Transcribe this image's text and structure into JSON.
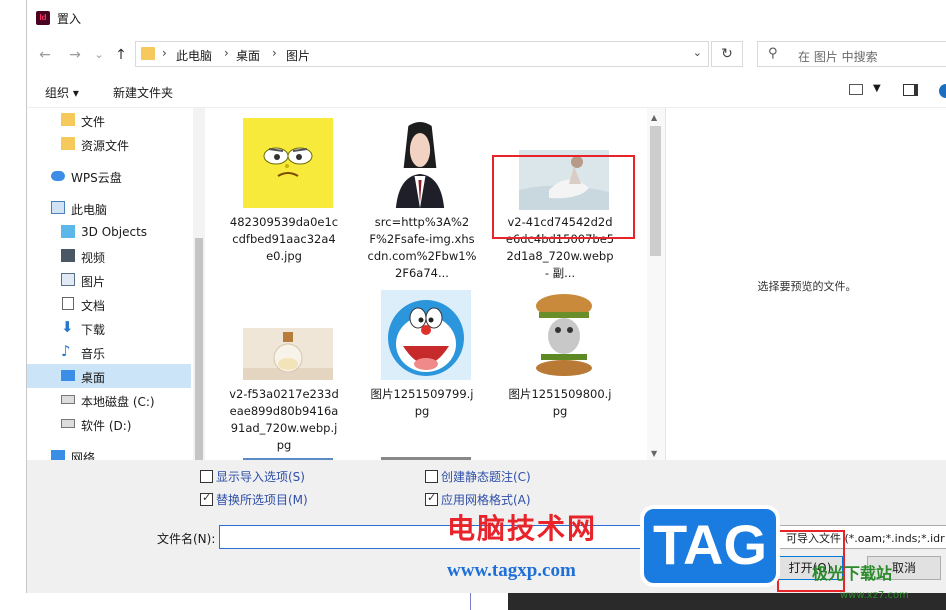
{
  "window": {
    "title": "置入",
    "app_icon_text": "Id"
  },
  "address": {
    "back": "←",
    "forward": "→",
    "recent": "⌄",
    "up": "↑",
    "crumbs": [
      "此电脑",
      "桌面",
      "图片"
    ],
    "search_placeholder": "在 图片 中搜索"
  },
  "toolbar": {
    "organize": "组织 ▾",
    "new_folder": "新建文件夹"
  },
  "sidebar": {
    "items": [
      {
        "label": "文件",
        "icon": "folder-icon"
      },
      {
        "label": "资源文件",
        "icon": "folder-icon"
      },
      {
        "label": "WPS云盘",
        "icon": "cloud-icon"
      },
      {
        "label": "此电脑",
        "icon": "computer-icon"
      },
      {
        "label": "3D Objects",
        "icon": "cube-icon"
      },
      {
        "label": "视频",
        "icon": "video-icon"
      },
      {
        "label": "图片",
        "icon": "picture-icon"
      },
      {
        "label": "文档",
        "icon": "document-icon"
      },
      {
        "label": "下载",
        "icon": "download-icon"
      },
      {
        "label": "音乐",
        "icon": "music-icon"
      },
      {
        "label": "桌面",
        "icon": "desktop-icon",
        "selected": true
      },
      {
        "label": "本地磁盘 (C:)",
        "icon": "drive-icon"
      },
      {
        "label": "软件 (D:)",
        "icon": "drive-icon"
      },
      {
        "label": "网络",
        "icon": "network-icon"
      }
    ]
  },
  "files": [
    {
      "name": "482309539da0e1ccdfbed91aac32a4e0.jpg",
      "thumb": "spongebob-thumbnail"
    },
    {
      "name": "src=http%3A%2F%2Fsafe-img.xhscdn.com%2Fbw1%2F6a74...",
      "thumb": "portrait-thumbnail"
    },
    {
      "name": "v2-41cd74542d2de6dc4bd15007be52d1a8_720w.webp - 副...",
      "thumb": "photo-thumbnail",
      "highlighted": true
    },
    {
      "name": "v2-f53a0217e233deae899d80b9416a91ad_720w.webp.jpg",
      "thumb": "bottle-thumbnail"
    },
    {
      "name": "图片1251509799.jpg",
      "thumb": "doraemon-thumbnail"
    },
    {
      "name": "图片1251509800.jpg",
      "thumb": "cat-burger-thumbnail"
    }
  ],
  "preview": {
    "text": "选择要预览的文件。"
  },
  "options": {
    "show_import": {
      "label": "显示导入选项(S)",
      "checked": false
    },
    "create_caption": {
      "label": "创建静态题注(C)",
      "checked": false
    },
    "replace_selected": {
      "label": "替换所选项目(M)",
      "checked": true
    },
    "apply_grid": {
      "label": "应用网格格式(A)",
      "checked": true
    }
  },
  "filename": {
    "label": "文件名(N):",
    "value": ""
  },
  "filter": {
    "value": "可导入文件 (*.oam;*.inds;*.idr"
  },
  "buttons": {
    "open": "打开(O)",
    "cancel": "取消"
  },
  "watermark": {
    "cn": "电脑技术网",
    "url": "www.tagxp.com",
    "tag": "TAG",
    "corner": "极光下载站",
    "corner_url": "www.xz7.com"
  },
  "colors": {
    "highlight": "#e8232a",
    "selection": "#cce4f7",
    "link": "#2f4fa8"
  }
}
